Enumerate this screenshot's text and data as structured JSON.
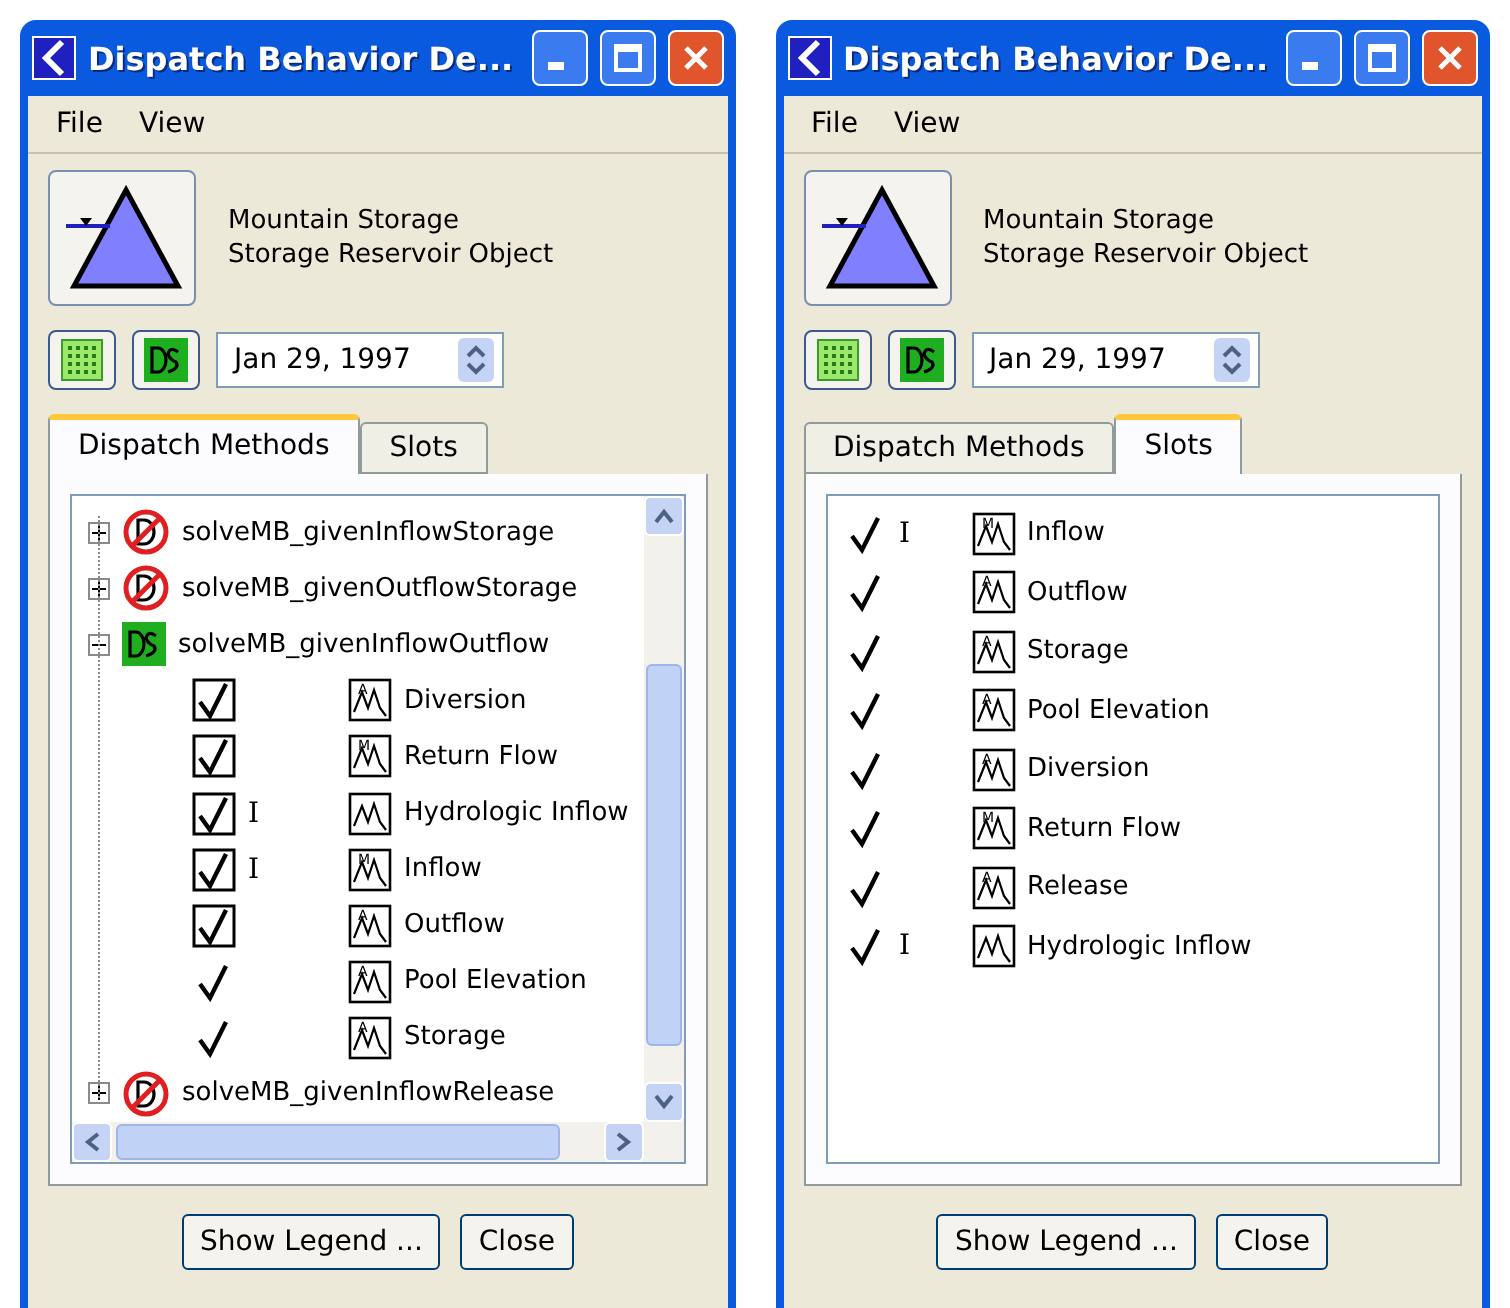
{
  "windows": [
    {
      "title": "Dispatch Behavior De...",
      "menu": [
        "File",
        "View"
      ],
      "object_name": "Mountain Storage",
      "object_type": "Storage Reservoir Object",
      "date": "Jan 29, 1997",
      "tabs": [
        {
          "label": "Dispatch Methods",
          "selected": true
        },
        {
          "label": "Slots",
          "selected": false
        }
      ],
      "kind": "methods",
      "methods": [
        {
          "name": "solveMB_givenInflowStorage",
          "kind": "disabled",
          "expanded": false
        },
        {
          "name": "solveMB_givenOutflowStorage",
          "kind": "disabled",
          "expanded": false
        },
        {
          "name": "solveMB_givenInflowOutflow",
          "kind": "ds",
          "expanded": true,
          "slots": [
            {
              "name": "Diversion",
              "boxed": true,
              "mark_letter": "A"
            },
            {
              "name": "Return Flow",
              "boxed": true,
              "mark_letter": "M"
            },
            {
              "name": "Hydrologic Inflow",
              "boxed": true,
              "flag": "I"
            },
            {
              "name": "Inflow",
              "boxed": true,
              "flag": "I",
              "mark_letter": "M"
            },
            {
              "name": "Outflow",
              "boxed": true,
              "mark_letter": "A"
            },
            {
              "name": "Pool Elevation",
              "boxed": false,
              "mark_letter": "A"
            },
            {
              "name": "Storage",
              "boxed": false,
              "mark_letter": "A"
            }
          ]
        },
        {
          "name": "solveMB_givenInflowRelease",
          "kind": "disabled",
          "expanded": false
        }
      ],
      "buttons": [
        "Show Legend ...",
        "Close"
      ]
    },
    {
      "title": "Dispatch Behavior De...",
      "menu": [
        "File",
        "View"
      ],
      "object_name": "Mountain Storage",
      "object_type": "Storage Reservoir Object",
      "date": "Jan 29, 1997",
      "tabs": [
        {
          "label": "Dispatch Methods",
          "selected": false
        },
        {
          "label": "Slots",
          "selected": true
        }
      ],
      "kind": "slots",
      "slots": [
        {
          "name": "Inflow",
          "boxed": false,
          "flag": "I",
          "mark_letter": "M"
        },
        {
          "name": "Outflow",
          "boxed": false,
          "mark_letter": "A"
        },
        {
          "name": "Storage",
          "boxed": false,
          "mark_letter": "A"
        },
        {
          "name": "Pool Elevation",
          "boxed": false,
          "mark_letter": "A"
        },
        {
          "name": "Diversion",
          "boxed": false,
          "mark_letter": "A"
        },
        {
          "name": "Return Flow",
          "boxed": false,
          "mark_letter": "M"
        },
        {
          "name": "Release",
          "boxed": false,
          "mark_letter": "A"
        },
        {
          "name": "Hydrologic Inflow",
          "boxed": false,
          "flag": "I"
        }
      ],
      "buttons": [
        "Show Legend ...",
        "Close"
      ]
    }
  ]
}
